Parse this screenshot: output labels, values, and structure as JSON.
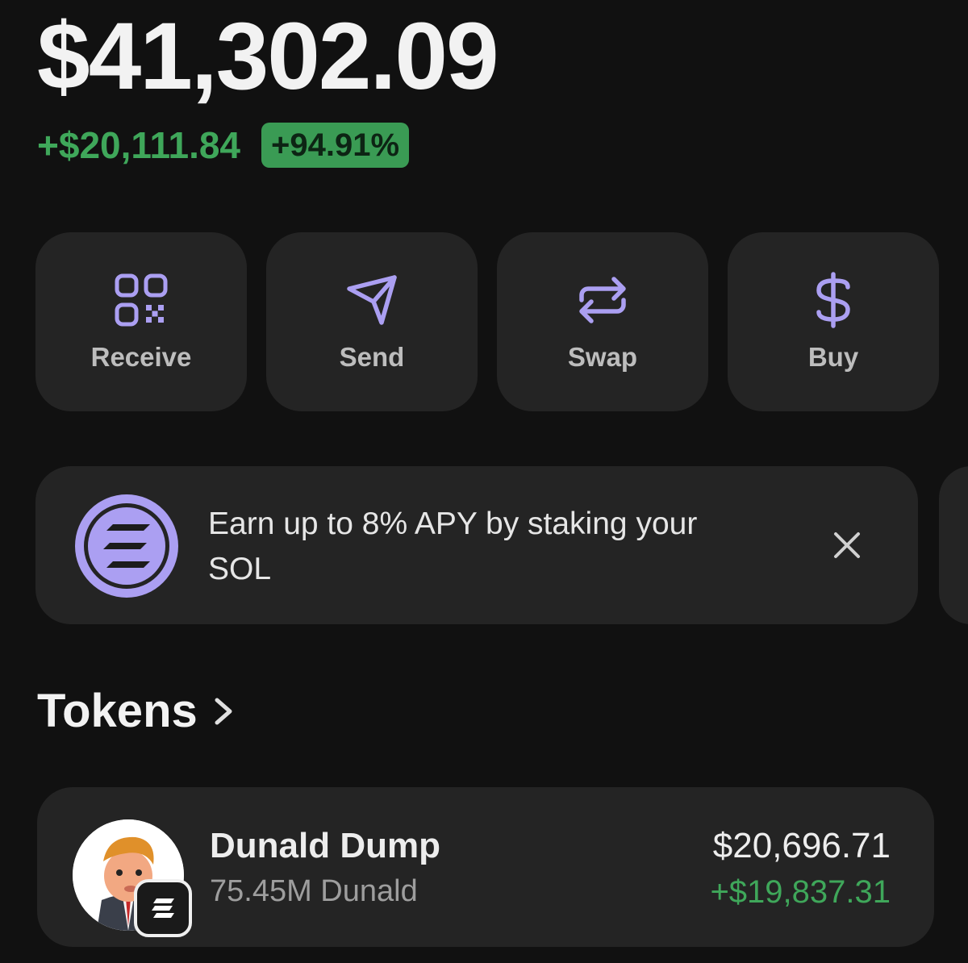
{
  "portfolio": {
    "balance": "$41,302.09",
    "change_amount": "+$20,111.84",
    "change_percent": "+94.91%"
  },
  "actions": [
    {
      "label": "Receive",
      "icon": "qr-code-icon"
    },
    {
      "label": "Send",
      "icon": "send-icon"
    },
    {
      "label": "Swap",
      "icon": "swap-icon"
    },
    {
      "label": "Buy",
      "icon": "dollar-icon"
    }
  ],
  "banner": {
    "text": "Earn up to 8% APY by staking your SOL",
    "icon": "solana-logo-icon",
    "close_icon": "close-icon"
  },
  "tokens_section": {
    "title": "Tokens"
  },
  "tokens": [
    {
      "name": "Dunald Dump",
      "quantity": "75.45M Dunald",
      "value": "$20,696.71",
      "pnl": "+$19,837.31"
    }
  ],
  "colors": {
    "accent": "#ab9ff2",
    "positive": "#3fa75a",
    "card": "#242424",
    "background": "#111111"
  }
}
